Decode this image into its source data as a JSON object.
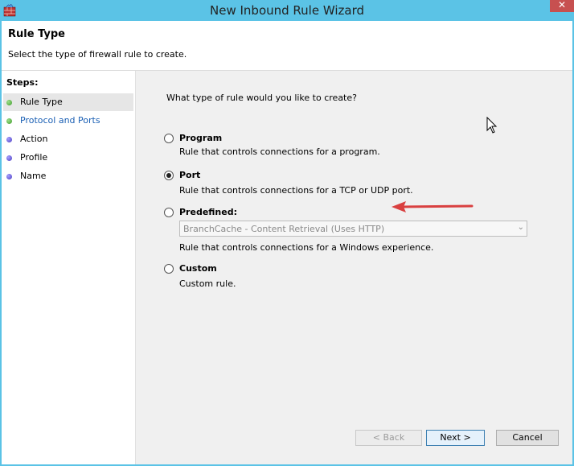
{
  "window": {
    "title": "New Inbound Rule Wizard",
    "close_label": "✕"
  },
  "header": {
    "title": "Rule Type",
    "description": "Select the type of firewall rule to create."
  },
  "steps": {
    "label": "Steps:",
    "items": [
      {
        "label": "Rule Type",
        "status": "completed",
        "color": "#3d9a2a"
      },
      {
        "label": "Protocol and Ports",
        "status": "completed",
        "color": "#3d9a2a"
      },
      {
        "label": "Action",
        "status": "pending",
        "color": "#4a3cc0"
      },
      {
        "label": "Profile",
        "status": "pending",
        "color": "#4a3cc0"
      },
      {
        "label": "Name",
        "status": "pending",
        "color": "#4a3cc0"
      }
    ]
  },
  "main": {
    "question": "What type of rule would you like to create?",
    "options": [
      {
        "title": "Program",
        "description": "Rule that controls connections for a program.",
        "selected": false
      },
      {
        "title": "Port",
        "description": "Rule that controls connections for a TCP or UDP port.",
        "selected": true
      },
      {
        "title": "Predefined:",
        "description": "Rule that controls connections for a Windows experience.",
        "selected": false
      },
      {
        "title": "Custom",
        "description": "Custom rule.",
        "selected": false
      }
    ],
    "predefined_select": {
      "value": "BranchCache - Content Retrieval (Uses HTTP)",
      "enabled": false
    }
  },
  "buttons": {
    "back": "< Back",
    "next": "Next >",
    "cancel": "Cancel"
  },
  "annotation": {
    "arrow_color": "#d94040",
    "icon": "red-arrow-icon"
  }
}
